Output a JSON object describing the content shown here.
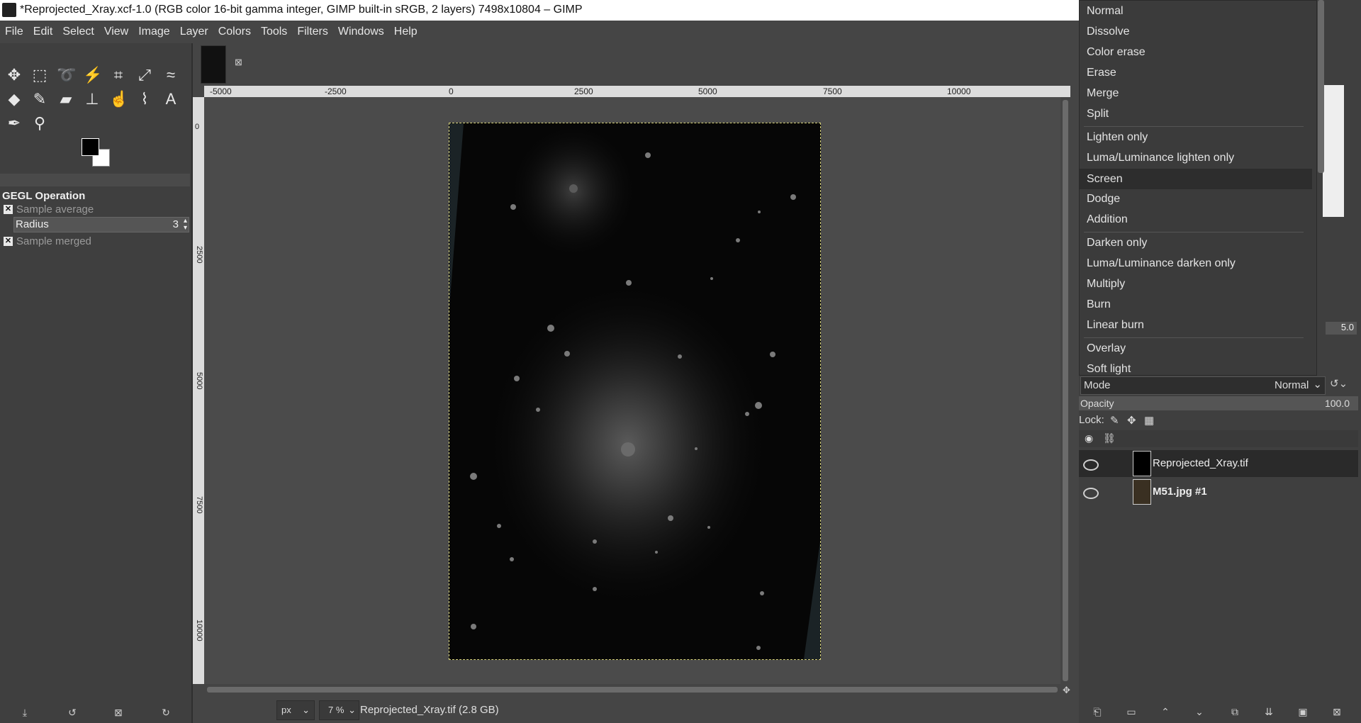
{
  "window": {
    "title": "*Reprojected_Xray.xcf-1.0 (RGB color 16-bit gamma integer, GIMP built-in sRGB, 2 layers) 7498x10804 – GIMP",
    "close_glyph": "✕"
  },
  "menubar": [
    "File",
    "Edit",
    "Select",
    "View",
    "Image",
    "Layer",
    "Colors",
    "Tools",
    "Filters",
    "Windows",
    "Help"
  ],
  "toolbox": {
    "tools": [
      "move-icon",
      "rect-select-icon",
      "lasso-icon",
      "fuzzy-select-icon",
      "crop-icon",
      "transform-icon",
      "warp-icon",
      "bucket-fill-icon",
      "paintbrush-icon",
      "eraser-icon",
      "clone-icon",
      "smudge-icon",
      "paths-icon",
      "text-icon",
      "color-picker-icon",
      "zoom-icon"
    ]
  },
  "tool_options": {
    "title": "GEGL Operation",
    "sample_average": "Sample average",
    "radius_label": "Radius",
    "radius_value": "3",
    "sample_merged": "Sample merged"
  },
  "ruler": {
    "h_ticks": [
      "-5000",
      "-2500",
      "0",
      "2500",
      "5000",
      "7500",
      "10000"
    ],
    "v_ticks": [
      "0",
      "2500",
      "5000",
      "7500",
      "10000"
    ]
  },
  "statusbar": {
    "unit": "px",
    "zoom": "7 %",
    "message": "Reprojected_Xray.tif (2.8 GB)"
  },
  "blend_modes": {
    "group1": [
      "Normal",
      "Dissolve",
      "Color erase",
      "Erase",
      "Merge",
      "Split"
    ],
    "group2": [
      "Lighten only",
      "Luma/Luminance lighten only",
      "Screen",
      "Dodge",
      "Addition"
    ],
    "group3": [
      "Darken only",
      "Luma/Luminance darken only",
      "Multiply",
      "Burn",
      "Linear burn"
    ],
    "group4": [
      "Overlay",
      "Soft light"
    ],
    "selected": "Screen"
  },
  "layers_panel": {
    "mode_label": "Mode",
    "mode_value": "Normal",
    "opacity_label": "Opacity",
    "opacity_value": "100.0",
    "lock_label": "Lock:",
    "brush_size": "5.0",
    "layers": [
      {
        "name": "Reprojected_Xray.tif",
        "visible": true,
        "active": true
      },
      {
        "name": "M51.jpg #1",
        "visible": true,
        "active": false
      }
    ]
  },
  "colors": {
    "bg": "#454545",
    "panel": "#3f3f3f",
    "image_border": "#d7d27a"
  }
}
